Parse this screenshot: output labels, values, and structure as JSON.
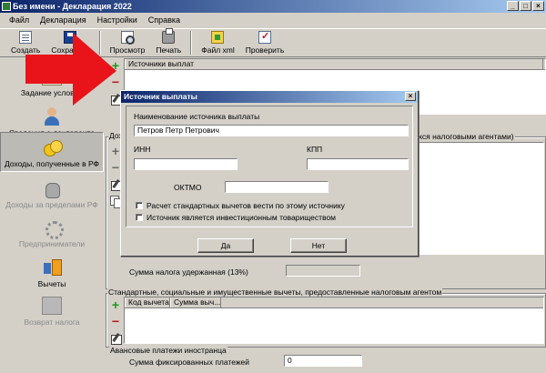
{
  "window": {
    "title": "Без имени - Декларация 2022"
  },
  "menu": [
    "Файл",
    "Декларация",
    "Настройки",
    "Справка"
  ],
  "toolbar": {
    "create_label": "Создать",
    "save_label": "Сохранить",
    "preview_label": "Просмотр",
    "print_label": "Печать",
    "xml_label": "Файл xml",
    "check_label": "Проверить"
  },
  "sidebar": {
    "items": [
      {
        "label": "Задание условий",
        "icon": "task-icon",
        "disabled": false
      },
      {
        "label": "Сведения о декларанте",
        "icon": "person-icon",
        "disabled": false
      },
      {
        "label": "Доходы, полученные в РФ",
        "icon": "coins-icon",
        "disabled": false,
        "selected": true
      },
      {
        "label": "Доходы за пределами РФ",
        "icon": "money-bag-icon",
        "disabled": true
      },
      {
        "label": "Предприниматели",
        "icon": "gear-icon",
        "disabled": true
      },
      {
        "label": "Вычеты",
        "icon": "deductions-icon",
        "disabled": false
      },
      {
        "label": "Возврат налога",
        "icon": "refund-icon",
        "disabled": true
      }
    ]
  },
  "main": {
    "sources_header": "Источники выплат",
    "income_group_partial": "Дох",
    "income_group_right_partial": "ихся налоговыми агентами)",
    "tax_withheld_label": "Сумма налога удержанная (13%)",
    "deductions_title": "Стандартные, социальные и имущественные вычеты, предоставленные налоговым агентом",
    "deductions_columns": [
      "Код вычета",
      "Сумма выч..."
    ],
    "advance_title": "Авансовые платежи иностранца",
    "fixed_payments_label": "Сумма фиксированных платежей",
    "fixed_payments_value": "0"
  },
  "dialog": {
    "title": "Источник выплаты",
    "name_label": "Наименование источника выплаты",
    "name_value": "Петров Петр Петрович",
    "inn_label": "ИНН",
    "inn_value": "",
    "kpp_label": "КПП",
    "kpp_value": "",
    "oktmo_label": "ОКТМО",
    "oktmo_value": "",
    "checkbox_standard": "Расчет стандартных вычетов вести по этому источнику",
    "checkbox_invest": "Источник является инвестиционным товариществом",
    "yes_label": "Да",
    "no_label": "Нет",
    "close_symbol": "×"
  },
  "window_buttons": {
    "minimize": "_",
    "maximize": "□",
    "close": "×"
  },
  "colors": {
    "arrow": "#e8141a",
    "titlebar": "#0a246a"
  }
}
